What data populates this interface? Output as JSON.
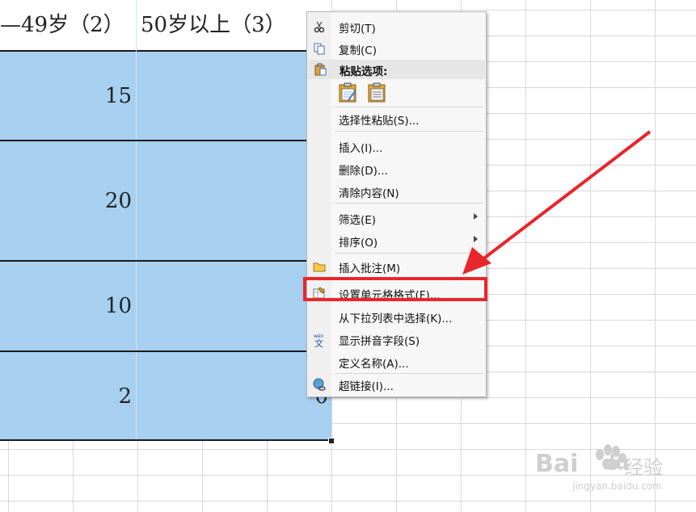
{
  "spreadsheet": {
    "headers": [
      "—49岁（2）",
      "50岁以上（3）"
    ],
    "col1_values": [
      "15",
      "20",
      "10",
      "2"
    ],
    "col2_values": [
      "0"
    ]
  },
  "context_menu": {
    "cut": "剪切(T)",
    "copy": "复制(C)",
    "paste_options": "粘贴选项:",
    "paste_special": "选择性粘贴(S)...",
    "insert": "插入(I)...",
    "delete": "删除(D)...",
    "clear_contents": "清除内容(N)",
    "filter": "筛选(E)",
    "sort": "排序(O)",
    "insert_comment": "插入批注(M)",
    "format_cells": "设置单元格格式(F)...",
    "pick_from_list": "从下拉列表中选择(K)...",
    "show_phonetic": "显示拼音字段(S)",
    "define_name": "定义名称(A)...",
    "hyperlink": "超链接(I)..."
  },
  "watermark": {
    "brand": "Bai",
    "brand2": "du",
    "cn": "经验",
    "url": "jingyan.baidu.com"
  },
  "colors": {
    "selection": "#a7cff0",
    "highlight": "#e8262b"
  }
}
